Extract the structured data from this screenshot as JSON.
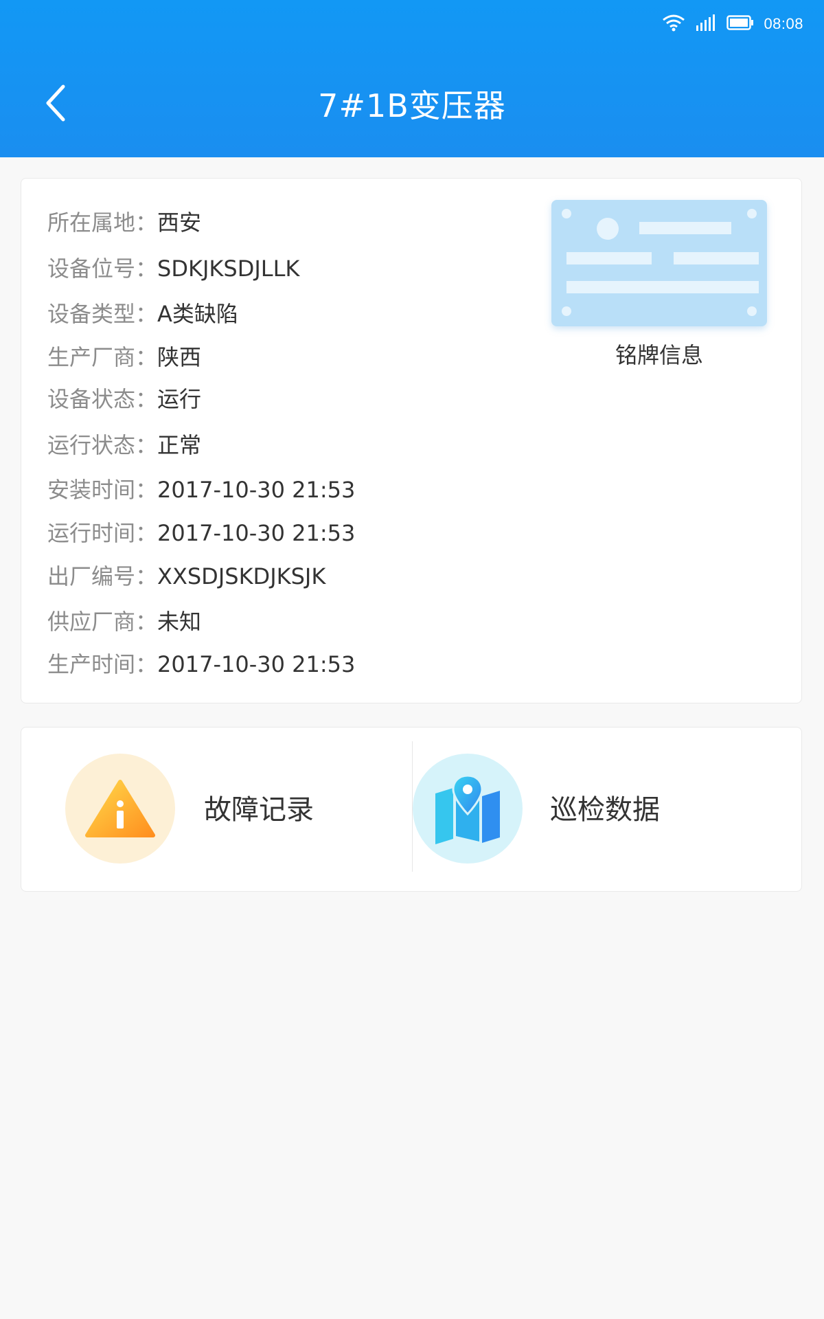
{
  "status_bar": {
    "time": "08:08",
    "icons": [
      "wifi-icon",
      "signal-icon",
      "battery-icon"
    ]
  },
  "header": {
    "title": "7#1B变压器",
    "back_icon": "chevron-left-icon"
  },
  "info": {
    "rows": [
      {
        "label": "所在属地：",
        "value": "西安"
      },
      {
        "label": "设备位号：",
        "value": "SDKJKSDJLLK"
      },
      {
        "label": "设备类型：",
        "value": "A类缺陷"
      },
      {
        "label": "生产厂商：",
        "value": "陕西"
      },
      {
        "label": "设备状态：",
        "value": "运行"
      },
      {
        "label": "运行状态：",
        "value": "正常"
      },
      {
        "label": "安装时间：",
        "value": "2017-10-30 21:53"
      },
      {
        "label": "运行时间：",
        "value": "2017-10-30 21:53"
      },
      {
        "label": "出厂编号：",
        "value": "XXSDJSKDJKSJK"
      },
      {
        "label": "供应厂商：",
        "value": "未知"
      },
      {
        "label": "生产时间：",
        "value": "2017-10-30 21:53"
      }
    ],
    "nameplate_label": "铭牌信息"
  },
  "actions": {
    "fault": {
      "label": "故障记录",
      "icon": "warning-icon"
    },
    "inspection": {
      "label": "巡检数据",
      "icon": "map-pin-icon"
    }
  },
  "colors": {
    "header_blue": "#1298f5",
    "label_gray": "#8c8c8c",
    "value_dark": "#333333",
    "nameplate_blue": "#b9dff8",
    "warning_bg": "#fdf0d6",
    "map_bg": "#d6f3fa"
  }
}
